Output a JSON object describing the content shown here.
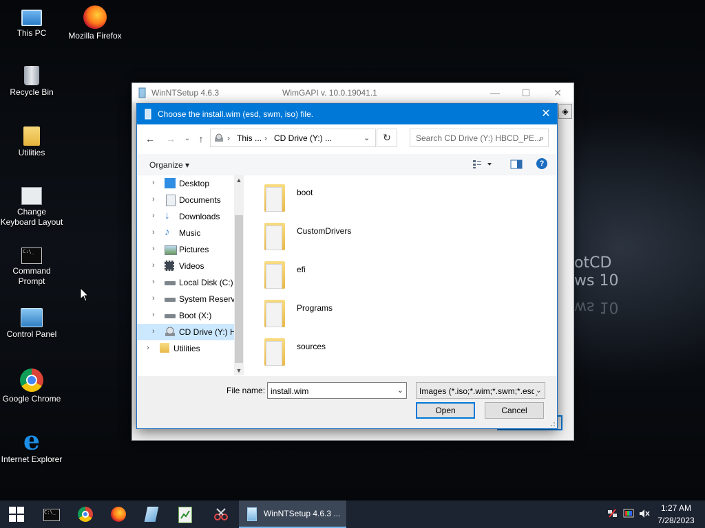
{
  "desktop": {
    "icons": [
      {
        "label": "This PC",
        "icon": "this-pc-icon"
      },
      {
        "label": "Mozilla Firefox",
        "icon": "firefox-icon"
      },
      {
        "label": "Recycle Bin",
        "icon": "recycle-bin-icon"
      },
      {
        "label": "Utilities",
        "icon": "folder-icon"
      },
      {
        "label1": "Change",
        "label2": "Keyboard Layout",
        "icon": "keyboard-layout-icon"
      },
      {
        "label1": "Command",
        "label2": "Prompt",
        "icon": "command-prompt-icon"
      },
      {
        "label": "Control Panel",
        "icon": "control-panel-icon"
      },
      {
        "label": "Google Chrome",
        "icon": "chrome-icon"
      },
      {
        "label": "Internet Explorer",
        "icon": "internet-explorer-icon"
      }
    ],
    "background_text": [
      "otCD",
      "ws 10",
      "ws 10"
    ]
  },
  "back_window": {
    "title": "WinNTSetup 4.6.3",
    "version": "WimGAPI v. 10.0.19041.1"
  },
  "dialog": {
    "title": "Choose the install.wim (esd, swm, iso) file.",
    "close": "✕",
    "address": {
      "crumb1": "This ...",
      "crumb2": "CD Drive (Y:) ..."
    },
    "search_placeholder": "Search CD Drive (Y:) HBCD_PE...",
    "organize_label": "Organize ▾",
    "nav_items": [
      {
        "label": "Desktop"
      },
      {
        "label": "Documents"
      },
      {
        "label": "Downloads"
      },
      {
        "label": "Music"
      },
      {
        "label": "Pictures"
      },
      {
        "label": "Videos"
      },
      {
        "label": "Local Disk (C:)"
      },
      {
        "label": "System Reserve"
      },
      {
        "label": "Boot (X:)"
      },
      {
        "label": "CD Drive (Y:) H"
      },
      {
        "label": "Utilities"
      }
    ],
    "folders": [
      "boot",
      "CustomDrivers",
      "efi",
      "Programs",
      "sources"
    ],
    "file_name_label": "File name:",
    "file_name_value": "install.wim",
    "file_type_value": "Images (*.iso;*.wim;*.swm;*.esd)",
    "open_label": "Open",
    "cancel_label": "Cancel"
  },
  "taskbar": {
    "active_window_label": "WinNTSetup 4.6.3  ...",
    "time": "1:27 AM",
    "date": "7/28/2023"
  },
  "colors": {
    "accent": "#0078d7",
    "taskbar": "#1c2331",
    "selection": "#cce8ff"
  }
}
